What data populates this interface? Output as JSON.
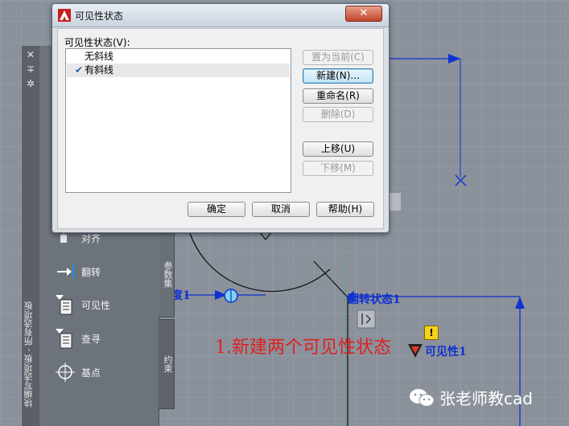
{
  "dialog": {
    "title": "可见性状态",
    "list_label": "可见性状态(V):",
    "states": [
      {
        "label": "无斜线",
        "checked": false,
        "selected": false
      },
      {
        "label": "有斜线",
        "checked": true,
        "selected": true
      }
    ],
    "checkmark": "✔",
    "buttons": {
      "set_current": "置为当前(C)",
      "new": "新建(N)...",
      "rename": "重命名(R)",
      "delete": "删除(D)",
      "move_up": "上移(U)",
      "move_down": "下移(M)",
      "ok": "确定",
      "cancel": "取消",
      "help": "帮助(H)"
    },
    "close_glyph": "✕"
  },
  "palette": {
    "title": "块编写选项板 - 所有选项板",
    "items": [
      {
        "label": "对齐",
        "icon": "align-icon"
      },
      {
        "label": "翻转",
        "icon": "flip-icon"
      },
      {
        "label": "可见性",
        "icon": "visibility-icon"
      },
      {
        "label": "查寻",
        "icon": "lookup-icon"
      },
      {
        "label": "基点",
        "icon": "basepoint-icon"
      }
    ],
    "tabs": [
      "参数集",
      "约束"
    ],
    "strip_buttons": {
      "close": "✕",
      "autohide": "∓",
      "properties": "✲"
    }
  },
  "canvas": {
    "annotation": "1.新建两个可见性状态",
    "flip_label": "翻转状态1",
    "visibility_label": "可见性1",
    "partial_label": "度1",
    "warning_glyph": "!"
  },
  "watermark": "张老师教cad",
  "colors": {
    "background": "#8a919b",
    "grid": "#9aa1aa",
    "param_blue": "#1030d0",
    "annotation_red": "#e02020"
  }
}
